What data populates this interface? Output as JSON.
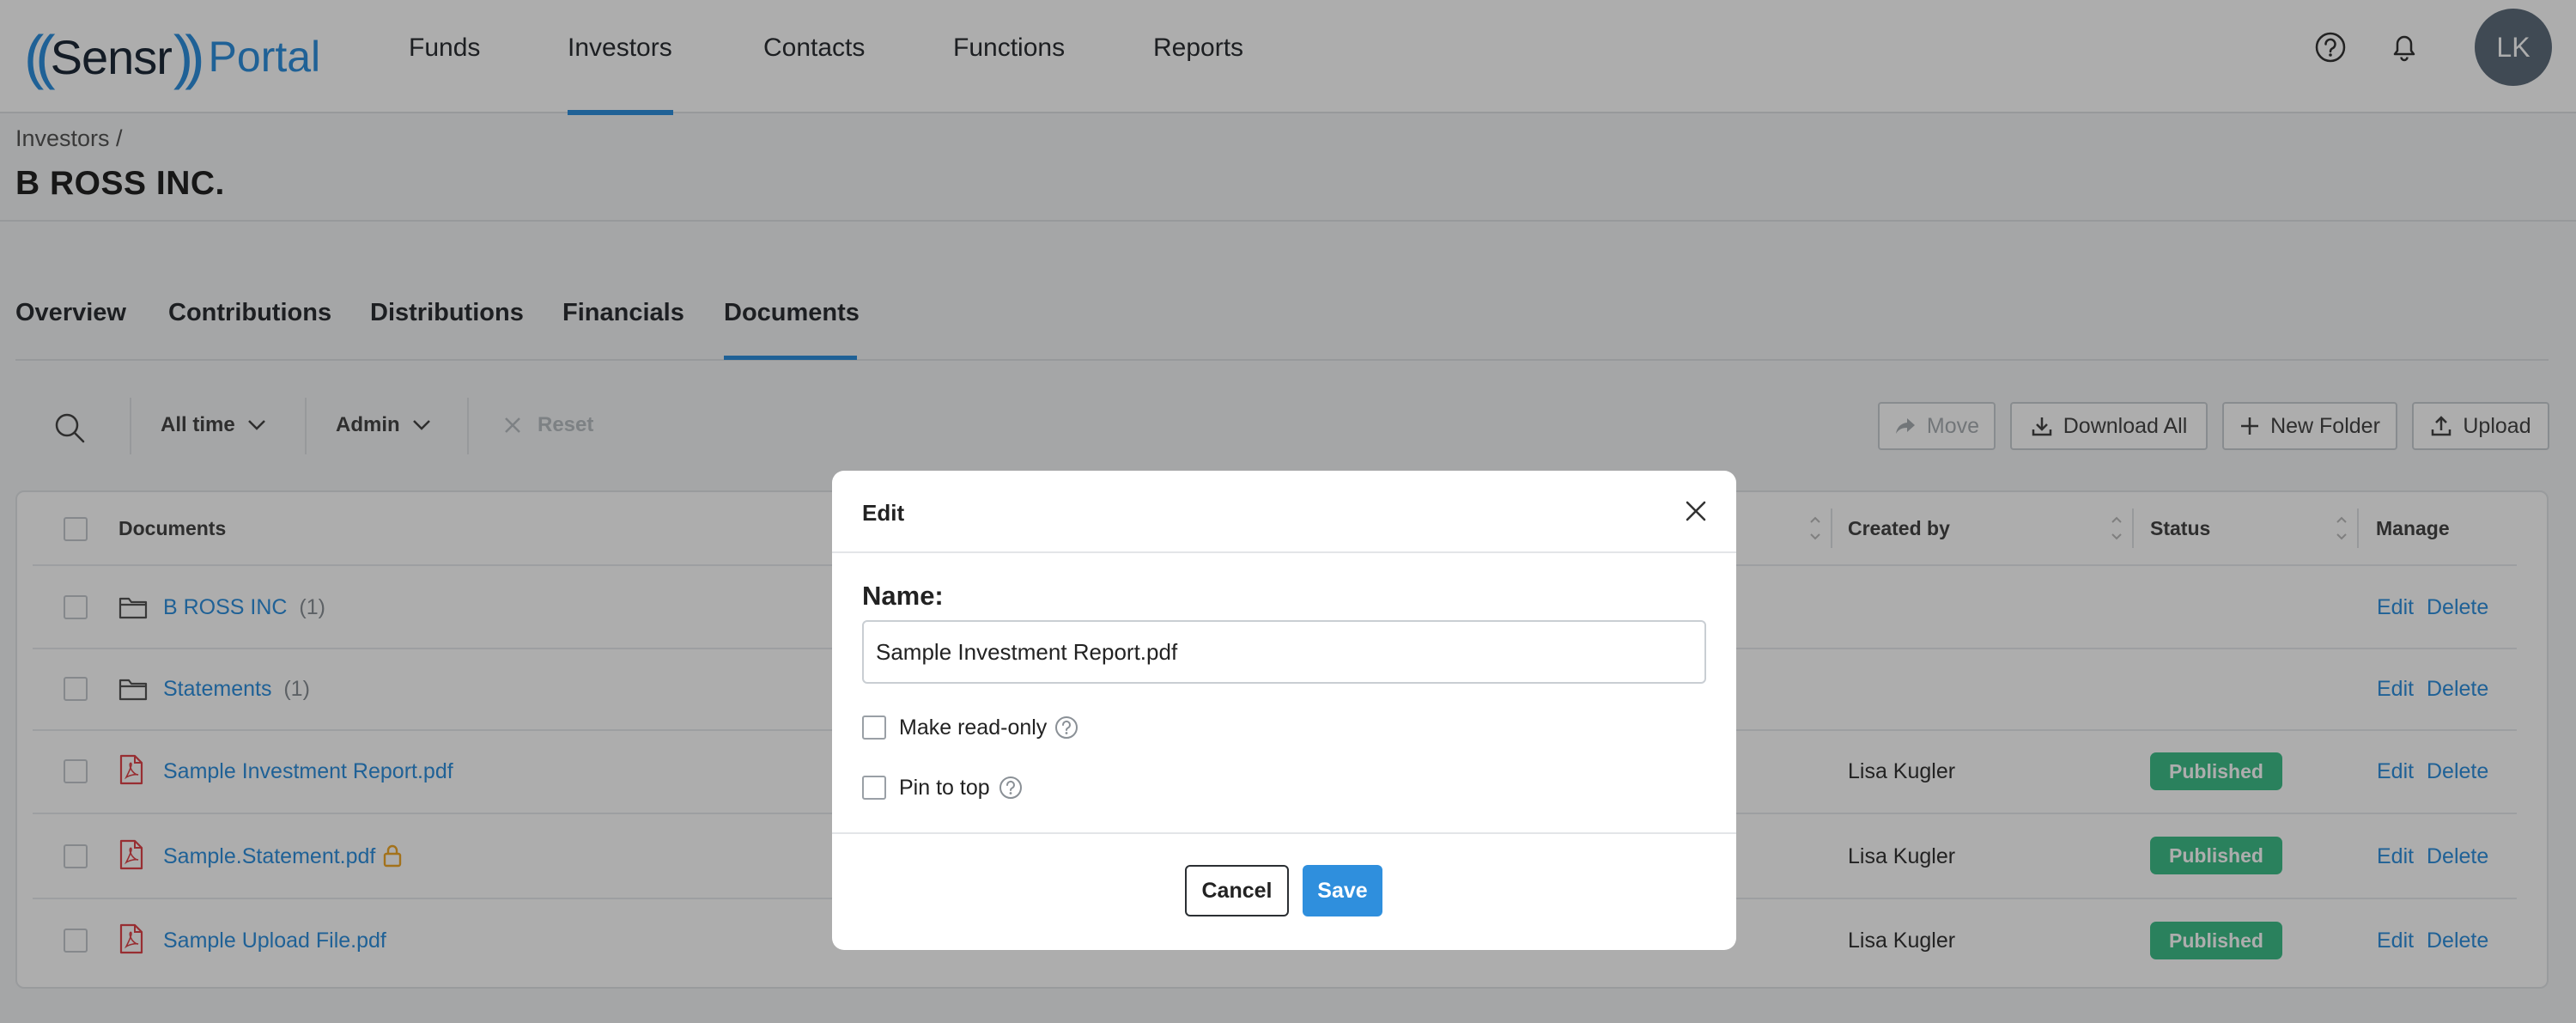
{
  "app": {
    "logo_text": "(( Sensr )) Portal",
    "user_initials": "LK"
  },
  "nav": {
    "items": [
      {
        "label": "Funds",
        "active": false
      },
      {
        "label": "Investors",
        "active": true
      },
      {
        "label": "Contacts",
        "active": false
      },
      {
        "label": "Functions",
        "active": false
      },
      {
        "label": "Reports",
        "active": false
      }
    ],
    "icons": [
      "help-circle-icon",
      "bell-icon"
    ]
  },
  "header": {
    "breadcrumb": "Investors /",
    "title": "B ROSS INC."
  },
  "tabs": [
    {
      "label": "Overview",
      "active": false
    },
    {
      "label": "Contributions",
      "active": false
    },
    {
      "label": "Distributions",
      "active": false
    },
    {
      "label": "Financials",
      "active": false
    },
    {
      "label": "Documents",
      "active": true
    }
  ],
  "filters": {
    "time": "All time",
    "role": "Admin",
    "reset": "Reset"
  },
  "toolbar": {
    "move": "Move",
    "download_all": "Download All",
    "new_folder": "New Folder",
    "upload": "Upload"
  },
  "table": {
    "columns": {
      "documents": "Documents",
      "created_by": "Created by",
      "status": "Status",
      "manage": "Manage"
    },
    "rows": [
      {
        "type": "folder",
        "name": "B ROSS INC",
        "count": "(1)",
        "created_by": "",
        "status": "",
        "edit": "Edit",
        "delete": "Delete",
        "locked": false
      },
      {
        "type": "folder",
        "name": "Statements",
        "count": "(1)",
        "created_by": "",
        "status": "",
        "edit": "Edit",
        "delete": "Delete",
        "locked": false
      },
      {
        "type": "pdf",
        "name": "Sample Investment Report.pdf",
        "count": "",
        "created_by": "Lisa Kugler",
        "status": "Published",
        "edit": "Edit",
        "delete": "Delete",
        "locked": false
      },
      {
        "type": "pdf",
        "name": "Sample.Statement.pdf",
        "count": "",
        "created_by": "Lisa Kugler",
        "status": "Published",
        "edit": "Edit",
        "delete": "Delete",
        "locked": true
      },
      {
        "type": "pdf",
        "name": "Sample Upload File.pdf",
        "count": "",
        "created_by": "Lisa Kugler",
        "status": "Published",
        "edit": "Edit",
        "delete": "Delete",
        "locked": false
      }
    ]
  },
  "modal": {
    "title": "Edit",
    "name_label": "Name:",
    "name_value": "Sample Investment Report.pdf",
    "read_only_label": "Make read-only",
    "read_only_checked": false,
    "pin_label": "Pin to top",
    "pin_checked": false,
    "cancel": "Cancel",
    "save": "Save"
  },
  "colors": {
    "accent": "#2f8fdd",
    "published": "#3fbf8a",
    "pdf_icon": "#e0454b"
  }
}
